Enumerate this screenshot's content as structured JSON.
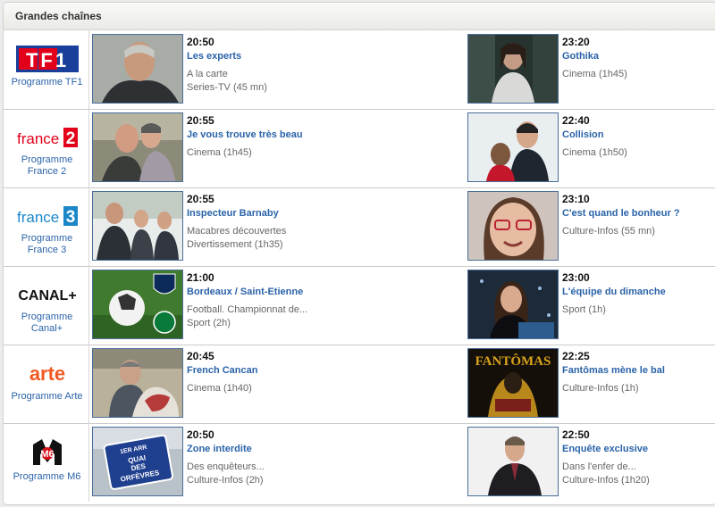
{
  "section_title": "Grandes chaînes",
  "channels": [
    {
      "name": "TF1",
      "link_lines": [
        "Programme TF1"
      ],
      "programs": [
        {
          "time": "20:50",
          "title": "Les experts",
          "details": [
            "A la carte",
            "Series-TV (45 mn)"
          ]
        },
        {
          "time": "23:20",
          "title": "Gothika",
          "details": [
            "Cinema (1h45)"
          ]
        }
      ]
    },
    {
      "name": "France 2",
      "link_lines": [
        "Programme",
        "France 2"
      ],
      "programs": [
        {
          "time": "20:55",
          "title": "Je vous trouve très beau",
          "details": [
            "Cinema (1h45)"
          ]
        },
        {
          "time": "22:40",
          "title": "Collision",
          "details": [
            "Cinema (1h50)"
          ]
        }
      ]
    },
    {
      "name": "France 3",
      "link_lines": [
        "Programme",
        "France 3"
      ],
      "programs": [
        {
          "time": "20:55",
          "title": "Inspecteur Barnaby",
          "details": [
            "Macabres découvertes",
            "Divertissement (1h35)"
          ]
        },
        {
          "time": "23:10",
          "title": "C'est quand le bonheur ?",
          "details": [
            "Culture-Infos (55 mn)"
          ]
        }
      ]
    },
    {
      "name": "Canal+",
      "link_lines": [
        "Programme",
        "Canal+"
      ],
      "programs": [
        {
          "time": "21:00",
          "title": "Bordeaux / Saint-Etienne",
          "details": [
            "Football. Championnat de...",
            "Sport (2h)"
          ]
        },
        {
          "time": "23:00",
          "title": "L'équipe du dimanche",
          "details": [
            "Sport (1h)"
          ]
        }
      ]
    },
    {
      "name": "Arte",
      "link_lines": [
        "Programme Arte"
      ],
      "programs": [
        {
          "time": "20:45",
          "title": "French Cancan",
          "details": [
            "Cinema (1h40)"
          ]
        },
        {
          "time": "22:25",
          "title": "Fantômas mène le bal",
          "details": [
            "Culture-Infos (1h)"
          ]
        }
      ]
    },
    {
      "name": "M6",
      "link_lines": [
        "Programme M6"
      ],
      "programs": [
        {
          "time": "20:50",
          "title": "Zone interdite",
          "details": [
            "Des enquêteurs...",
            "Culture-Infos (2h)"
          ]
        },
        {
          "time": "22:50",
          "title": "Enquête exclusive",
          "details": [
            "Dans l'enfer de...",
            "Culture-Infos (1h20)"
          ]
        }
      ]
    }
  ],
  "logos": {
    "tf1": "TF1",
    "france2": "france",
    "france2_num": "2",
    "france3": "france",
    "france3_num": "3",
    "canal": "CANAL+",
    "arte": "arte",
    "m6": "M6"
  },
  "thumb_texts": {
    "fantomas": "FANTÔMAS",
    "sign_line1": "1ER ARR",
    "sign_line2": "QUAI",
    "sign_line3": "DES",
    "sign_line4": "ORFÈVRES"
  },
  "colors": {
    "link": "#2a63a8",
    "tf1_blue": "#1a3f9a",
    "tf1_red": "#e3001b",
    "france2_red": "#e2001a",
    "france3_blue": "#1b87c9",
    "arte_orange": "#f05a22",
    "m6_red": "#d7111b"
  }
}
